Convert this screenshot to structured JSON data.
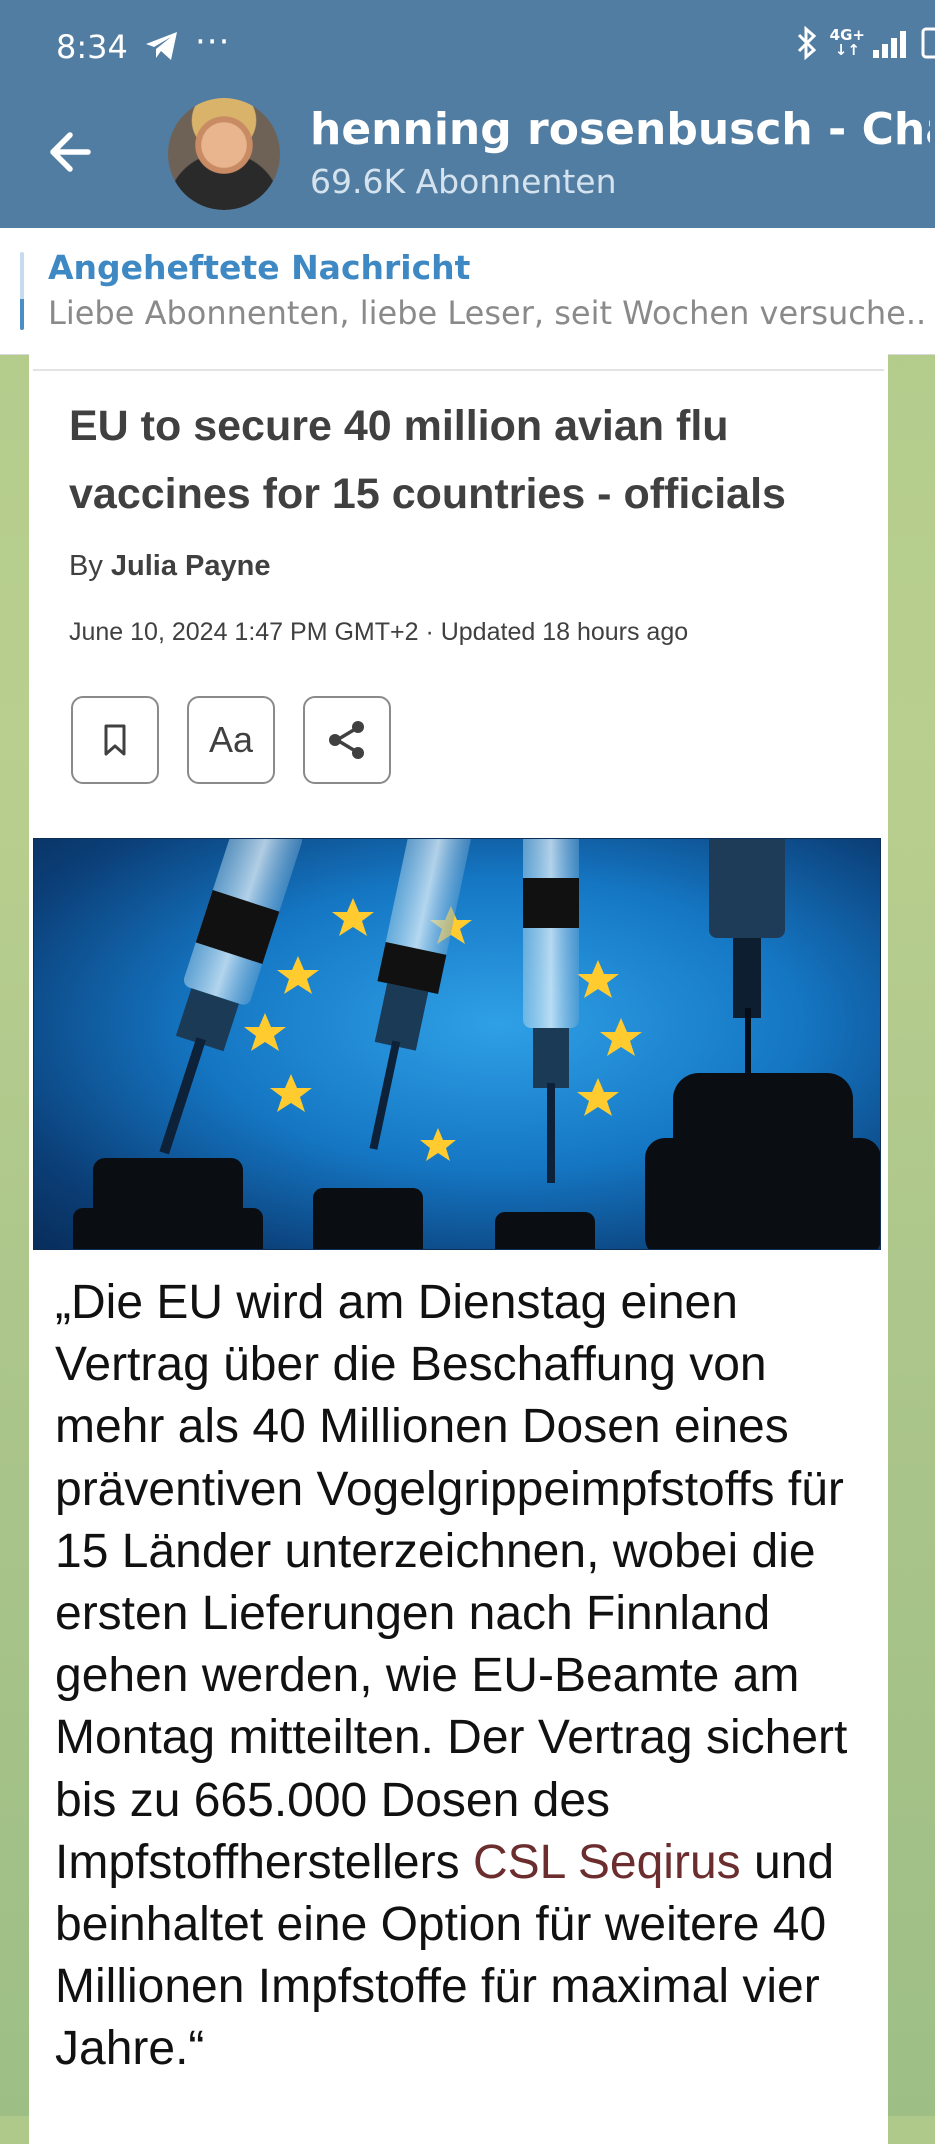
{
  "status_bar": {
    "time": "8:34",
    "network_label_top": "4G+",
    "network_label_bottom": "↓↑"
  },
  "header": {
    "channel_title": "henning rosenbusch - Chann",
    "subscribers": "69.6K Abonnenten"
  },
  "pinned": {
    "title": "Angeheftete Nachricht",
    "text": "Liebe Abonnenten, liebe Leser,  seit Wochen versuche..."
  },
  "article": {
    "headline": "EU to secure 40 million avian flu vaccines for 15 countries - officials",
    "byline_prefix": "By",
    "author": "Julia Payne",
    "dateline": "June 10, 2024 1:47 PM GMT+2 · Updated 18 hours ago",
    "text_size_label": "Aa"
  },
  "message": {
    "lines_before": "„Die EU wird am Dienstag einen Vertrag über die Beschaffung von mehr als 40 Millionen Dosen eines präventiven Vogelgrippeimpfstoffs für 15 Länder unterzeichnen, wobei die ersten Lieferungen nach Finnland gehen werden, wie EU-Beamte am Montag mitteilten. Der Vertrag sichert bis zu 665.000 Dosen des Impfstoffherstellers",
    "highlight": "CSL Seqirus",
    "lines_after": "und beinhaltet eine Option für weitere 40 Millionen Impfstoffe für maximal vier Jahre.“"
  },
  "colors": {
    "header_bg": "#517da2",
    "pinned_title": "#3e88c3",
    "highlight": "#f7a98f"
  }
}
